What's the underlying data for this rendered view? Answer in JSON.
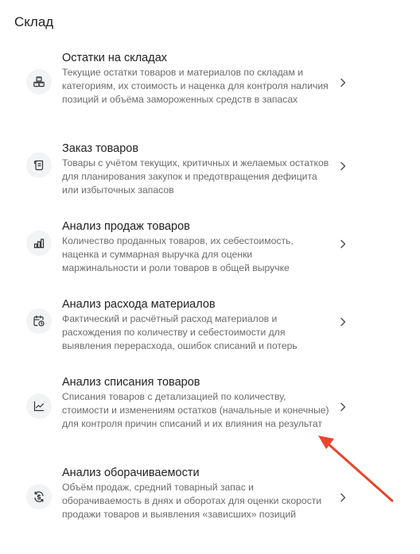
{
  "section": {
    "title": "Склад"
  },
  "items": [
    {
      "title": "Остатки на складах",
      "description": "Текущие остатки товаров и материалов по складам и категориям, их стоимость и наценка для контроля наличия позиций и объёма замороженных средств в запасах",
      "icon": "boxes-icon"
    },
    {
      "title": "Заказ товаров",
      "description": "Товары с учётом текущих, критичных и желаемых остатков для планирования закупок и предотвращения дефицита или избыточных запасов",
      "icon": "scroll-icon"
    },
    {
      "title": "Анализ продаж товаров",
      "description": "Количество проданных товаров, их себестоимость, наценка и суммарная выручка для оценки маржинальности и роли товаров в общей выручке",
      "icon": "bar-chart-icon"
    },
    {
      "title": "Анализ расхода материалов",
      "description": "Фактический и расчётный расход материалов и расхождения по количеству и себестоимости для выявления перерасхода, ошибок списаний и потерь",
      "icon": "calendar-clock-icon"
    },
    {
      "title": "Анализ списания товаров",
      "description": "Списания товаров с детализацией по количеству, стоимости и изменениям остатков (начальные и конечные) для контроля причин списаний и их влияния на результат",
      "icon": "line-chart-icon"
    },
    {
      "title": "Анализ оборачиваемости",
      "description": "Объём продаж, средний товарный запас и оборачиваемость в днях и оборотах для оценки скорости продажи товаров и выявления «зависших» позиций",
      "icon": "refresh-dollar-icon"
    }
  ],
  "annotation": {
    "color": "#e8452c"
  }
}
